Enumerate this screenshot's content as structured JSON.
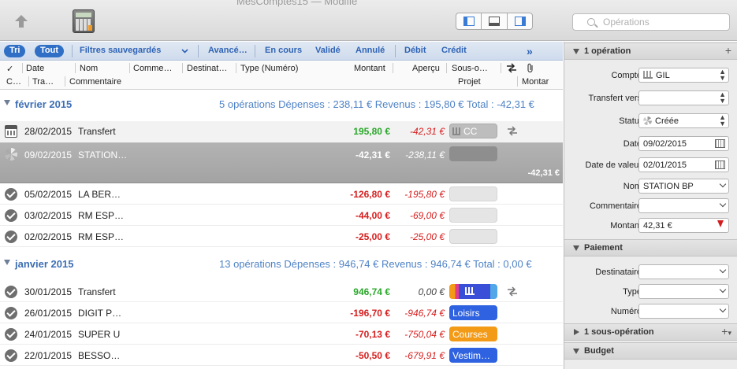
{
  "window": {
    "title": "MesComptes15 — Modifié"
  },
  "toolbar": {
    "search_placeholder": "Opérations"
  },
  "filters": {
    "tri": "Tri",
    "tout": "Tout",
    "saved": "Filtres sauvegardés",
    "advanced": "Avancé…",
    "en_cours": "En cours",
    "valide": "Validé",
    "annule": "Annulé",
    "debit": "Débit",
    "credit": "Crédit"
  },
  "columns": {
    "row1": {
      "check": "✓",
      "date": "Date",
      "nom": "Nom",
      "comment": "Comme…",
      "dest": "Destinat…",
      "type": "Type (Numéro)",
      "montant": "Montant",
      "apercu": "Aperçu",
      "sous": "Sous-o…"
    },
    "row2": {
      "c": "C…",
      "tra": "Tra…",
      "commentaire": "Commentaire",
      "projet": "Projet",
      "montar": "Montar"
    }
  },
  "groups": [
    {
      "name": "février 2015",
      "summary": "5 opérations  Dépenses : 238,11 €  Revenus : 195,80 €  Total : -42,31 €"
    },
    {
      "name": "janvier 2015",
      "summary": "13 opérations  Dépenses : 946,74 €  Revenus : 946,74 €  Total : 0,00 €"
    }
  ],
  "feb_rows": [
    {
      "date": "28/02/2015",
      "name": "Transfert",
      "amount": "195,80 €",
      "balance": "-42,31 €",
      "category": "CC"
    },
    {
      "date": "09/02/2015",
      "name": "STATION…",
      "amount": "-42,31 €",
      "balance": "-238,11 €",
      "category": "",
      "project_amount": "-42,31 €"
    },
    {
      "date": "05/02/2015",
      "name": "LA BER…",
      "amount": "-126,80 €",
      "balance": "-195,80 €",
      "category": ""
    },
    {
      "date": "03/02/2015",
      "name": "RM ESP…",
      "amount": "-44,00 €",
      "balance": "-69,00 €",
      "category": ""
    },
    {
      "date": "02/02/2015",
      "name": "RM ESP…",
      "amount": "-25,00 €",
      "balance": "-25,00 €",
      "category": ""
    }
  ],
  "jan_rows": [
    {
      "date": "30/01/2015",
      "name": "Transfert",
      "amount": "946,74 €",
      "balance": "0,00 €",
      "category": ""
    },
    {
      "date": "26/01/2015",
      "name": "DIGIT P…",
      "amount": "-196,70 €",
      "balance": "-946,74 €",
      "category": "Loisirs",
      "color": "#2f62e0"
    },
    {
      "date": "24/01/2015",
      "name": "SUPER U",
      "amount": "-70,13 €",
      "balance": "-750,04 €",
      "category": "Courses",
      "color": "#f39a16"
    },
    {
      "date": "22/01/2015",
      "name": "BESSO…",
      "amount": "-50,50 €",
      "balance": "-679,91 €",
      "category": "Vestim…",
      "color": "#2f62e0"
    }
  ],
  "inspector": {
    "section_operation": "1 opération",
    "compte_label": "Compte",
    "compte_value": "GIL",
    "transfert_label": "Transfert vers",
    "transfert_value": "",
    "statut_label": "Statut",
    "statut_value": "Créée",
    "date_label": "Date",
    "date_value": "09/02/2015",
    "date_valeur_label": "Date de valeur",
    "date_valeur_value": "02/01/2015",
    "nom_label": "Nom",
    "nom_value": "STATION BP",
    "commentaire_label": "Commentaire",
    "commentaire_value": "",
    "montant_label": "Montant",
    "montant_value": "42,31 €",
    "section_paiement": "Paiement",
    "destinataire_label": "Destinataire",
    "destinataire_value": "",
    "type_label": "Type",
    "type_value": "",
    "numero_label": "Numéro",
    "numero_value": "",
    "section_sous": "1 sous-opération",
    "section_budget": "Budget"
  }
}
